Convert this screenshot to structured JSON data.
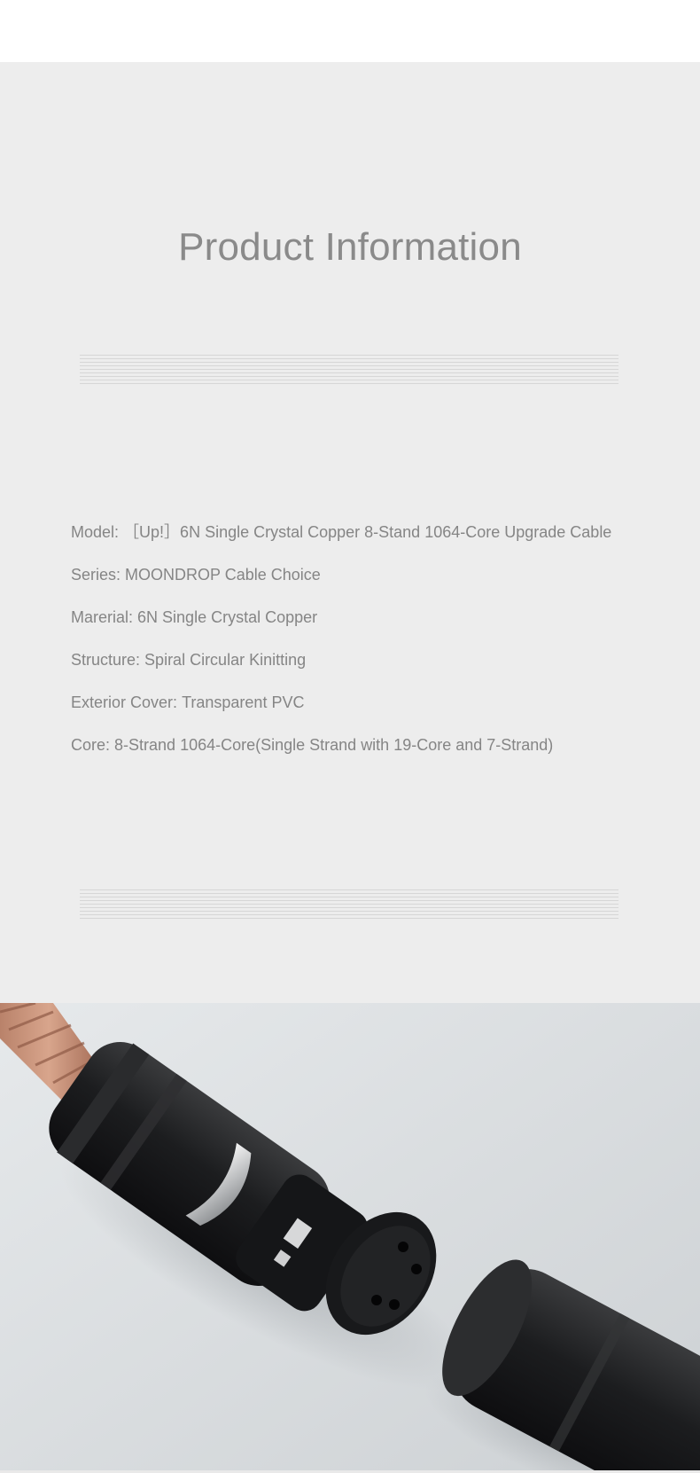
{
  "page": {
    "background": "#ffffff",
    "panel_color": "#ededed",
    "text_color": "#858585"
  },
  "product_info": {
    "title": "Product Information",
    "specs": [
      {
        "label": "Model:",
        "value": "［Up!］6N Single Crystal Copper 8-Stand 1064-Core Upgrade Cable"
      },
      {
        "label": "Series:",
        "value": "MOONDROP Cable Choice"
      },
      {
        "label": "Marerial:",
        "value": "6N Single Crystal Copper"
      },
      {
        "label": "Structure:",
        "value": "Spiral Circular Kinitting"
      },
      {
        "label": "Exterior Cover:",
        "value": "Transparent PVC"
      },
      {
        "label": "Core:",
        "value": "8-Strand 1064-Core(Single Strand with 19-Core and 7-Strand)"
      }
    ]
  },
  "photo": {
    "subject": "XLR connectors with braided copper cable"
  }
}
